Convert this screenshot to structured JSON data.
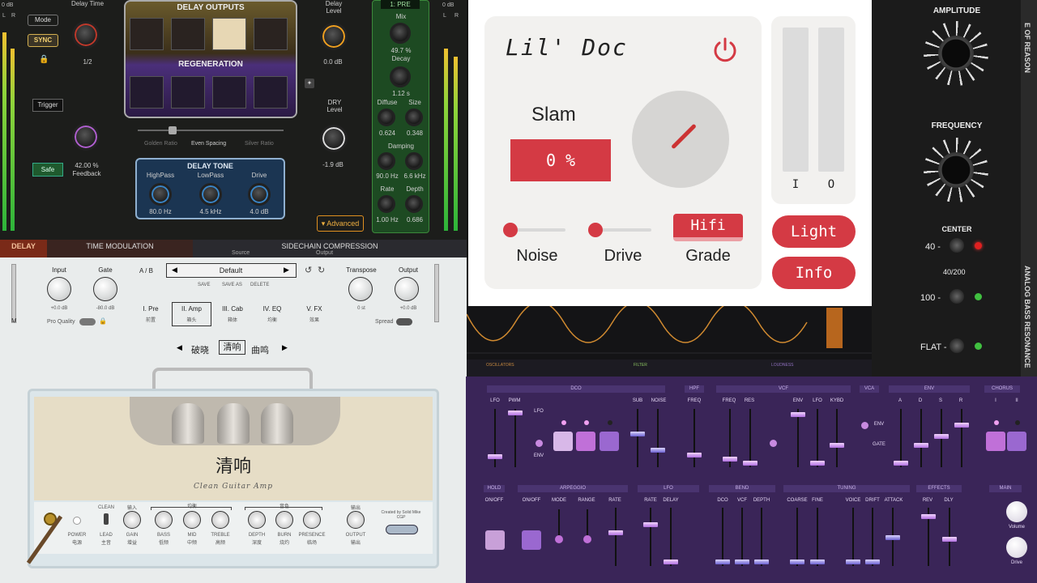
{
  "delay": {
    "mode_label": "Mode",
    "sync_label": "SYNC",
    "delay_time_label": "Delay Time",
    "delay_time_value": "1/2",
    "outputs_title": "DELAY OUTPUTS",
    "regen_title": "REGENERATION",
    "delay_level_label": "Delay Level",
    "delay_level_value": "0.0 dB",
    "dry_level_label": "DRY Level",
    "dry_level_value": "-1.9 dB",
    "trigger_label": "Trigger",
    "safe_label": "Safe",
    "feedback_value": "42.00 %",
    "feedback_label": "Feedback",
    "spacing_left": "Golden Ratio",
    "spacing_mid": "Even Spacing",
    "spacing_right": "Silver Ratio",
    "tone_title": "DELAY TONE",
    "highpass_label": "HighPass",
    "highpass_value": "80.0 Hz",
    "lowpass_label": "LowPass",
    "lowpass_value": "4.5 kHz",
    "drive_label": "Drive",
    "drive_value": "4.0 dB",
    "advanced_label": "▾ Advanced",
    "pre_label": "1: PRE",
    "mix_label": "Mix",
    "mix_value": "49.7 %",
    "decay_label": "Decay",
    "decay_value": "1.12 s",
    "diffuse_label": "Diffuse",
    "diffuse_value": "0.624",
    "size_label": "Size",
    "size_value": "0.348",
    "damping_label": "Damping",
    "damp_lo_value": "90.0 Hz",
    "damp_hi_value": "6.6 kHz",
    "rate_label": "Rate",
    "rate_value": "1.00 Hz",
    "depth_label": "Depth",
    "depth_value": "0.686",
    "meter_db_left": "0 dB",
    "meter_db_right": "0 dB",
    "meter_l": "L",
    "meter_r": "R",
    "tab_delay": "DELAY",
    "tab_time_mod": "TIME MODULATION",
    "tab_sidechain": "SIDECHAIN COMPRESSION",
    "tab_source": "Source",
    "tab_output": "Output"
  },
  "doc": {
    "title": "Lil' Doc",
    "slam_label": "Slam",
    "slam_value": "0 %",
    "noise_label": "Noise",
    "drive_label": "Drive",
    "grade_label": "Grade",
    "grade_value": "Hifi",
    "meter_in": "I",
    "meter_out": "O",
    "light_button": "Light",
    "info_button": "Info",
    "accent": "#d43a44"
  },
  "reason": {
    "brand": "E OF REASON",
    "amplitude_label": "AMPLITUDE",
    "frequency_label": "FREQUENCY",
    "center_label": "CENTER",
    "opt_40": "40 -",
    "opt_40_200": "40/200",
    "opt_100": "100 -",
    "opt_flat": "FLAT -",
    "side_title": "ANALOG BASS RESONANCE"
  },
  "amp": {
    "input_label": "Input",
    "input_value": "+0.0 dB",
    "gate_label": "Gate",
    "gate_value": "-80.0 dB",
    "ab_label": "A / B",
    "preset_name": "Default",
    "save": "SAVE",
    "save_as": "SAVE AS",
    "delete": "DELETE",
    "transpose_label": "Transpose",
    "transpose_value": "0 st",
    "output_label": "Output",
    "output_value": "+0.0 dB",
    "pro_quality": "Pro Quality",
    "spread": "Spread",
    "m_label": "M",
    "tabs": [
      {
        "label": "I. Pre",
        "sub": "前置"
      },
      {
        "label": "II. Amp",
        "sub": "箱头"
      },
      {
        "label": "III. Cab",
        "sub": "箱体"
      },
      {
        "label": "IV. EQ",
        "sub": "均衡"
      },
      {
        "label": "V. FX",
        "sub": "效果"
      }
    ],
    "mode_left": "破晓",
    "mode_current": "清响",
    "mode_right": "曲鸣",
    "amp_name_cn": "清响",
    "amp_name_en": "Clean Guitar Amp",
    "power_label": "POWER",
    "power_sub": "电源",
    "clean_label": "CLEAN",
    "lead_label": "LEAD",
    "lead_sub": "主音",
    "controls": [
      {
        "label": "GAIN",
        "sub": "增益",
        "head": "输入"
      },
      {
        "label": "BASS",
        "sub": "低频",
        "head": "均衡"
      },
      {
        "label": "MID",
        "sub": "中频",
        "head": ""
      },
      {
        "label": "TREBLE",
        "sub": "高频",
        "head": ""
      },
      {
        "label": "DEPTH",
        "sub": "深度",
        "head": "音色"
      },
      {
        "label": "BURN",
        "sub": "烧灼",
        "head": ""
      },
      {
        "label": "PRESENCE",
        "sub": "临场",
        "head": ""
      },
      {
        "label": "OUTPUT",
        "sub": "输出",
        "head": "输出"
      }
    ],
    "credit": "Created by Solid Mike CGP"
  },
  "synth": {
    "tab_osc": "OSCILLATORS",
    "tab_filter": "FILTER",
    "tab_loud": "LOUDNESS",
    "sec_dco": "DCO",
    "sec_hpf": "HPF",
    "sec_vcf": "VCF",
    "sec_vca": "VCA",
    "sec_env": "ENV",
    "sec_chorus": "CHORUS",
    "sec_hold": "HOLD",
    "sec_arp": "ARPEGGIO",
    "sec_lfo": "LFO",
    "sec_bend": "BEND",
    "sec_tuning": "TUNING",
    "sec_effects": "EFFECTS",
    "sec_main": "MAIN",
    "dco_lfo": "LFO",
    "dco_pwm": "PWM",
    "dco_lfo2": "LFO",
    "dco_env": "ENV",
    "dco_sub": "SUB",
    "dco_noise": "NOISE",
    "hpf_freq": "FREQ",
    "vcf_freq": "FREQ",
    "vcf_res": "RES",
    "vcf_env": "ENV",
    "vcf_lfo": "LFO",
    "vcf_kybd": "KYBD",
    "vca_env": "ENV",
    "vca_gate": "GATE",
    "env_a": "A",
    "env_d": "D",
    "env_s": "S",
    "env_r": "R",
    "chorus_1": "I",
    "chorus_2": "II",
    "hold_onoff": "ON/OFF",
    "arp_onoff": "ON/OFF",
    "arp_mode": "MODE",
    "arp_range": "RANGE",
    "arp_rate": "RATE",
    "lfo_rate": "RATE",
    "lfo_delay": "DELAY",
    "bend_dco": "DCO",
    "bend_vcf": "VCF",
    "bend_depth": "DEPTH",
    "tune_coarse": "COARSE",
    "tune_fine": "FINE",
    "tune_voice": "VOICE",
    "tune_drift": "DRIFT",
    "tune_attack": "ATTACK",
    "fx_rev": "REV",
    "fx_dly": "DLY",
    "main_volume": "Volume",
    "main_drive": "Drive"
  }
}
